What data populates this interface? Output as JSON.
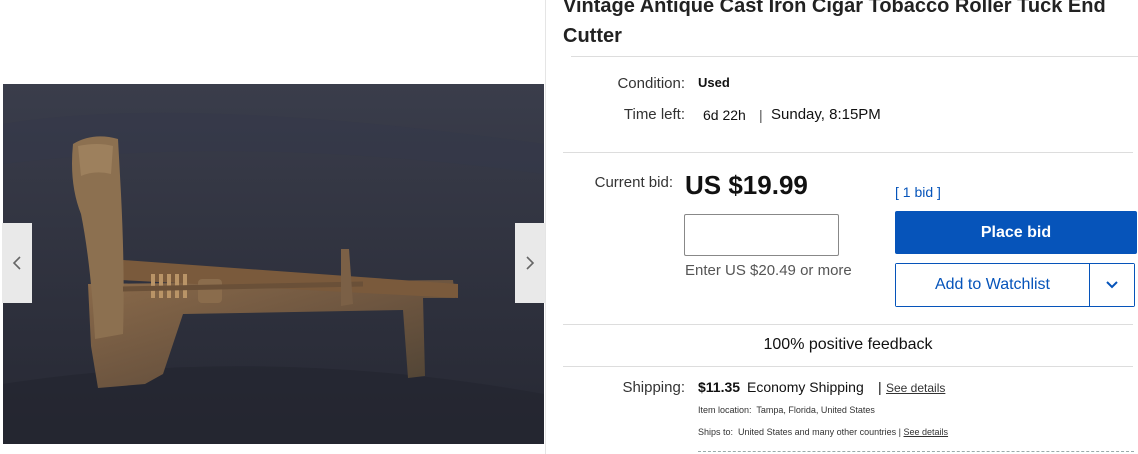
{
  "listing": {
    "title": "Vintage Antique Cast Iron Cigar Tobacco Roller Tuck End Cutter"
  },
  "gallery": {
    "prev_icon": "chevron-left-icon",
    "next_icon": "chevron-right-icon"
  },
  "details": {
    "condition_label": "Condition:",
    "condition_value": "Used",
    "time_left_label": "Time left:",
    "time_left_value": "6d 22h",
    "time_separator": "|",
    "end_time": "Sunday, 8:15PM"
  },
  "bid": {
    "current_bid_label": "Current bid:",
    "current_bid_value": "US $19.99",
    "bid_count": "1 bid",
    "input_value": "",
    "hint": "Enter US $20.49 or more",
    "place_bid_label": "Place bid",
    "watchlist_label": "Add to Watchlist",
    "watchlist_more_icon": "chevron-down-icon"
  },
  "seller": {
    "feedback": "100% positive feedback"
  },
  "shipping": {
    "label": "Shipping:",
    "cost": "$11.35",
    "method": "Economy Shipping",
    "separator": "|",
    "see_details": "See details",
    "item_location_label": "Item location:",
    "item_location_value": "Tampa, Florida, United States",
    "ships_to_label": "Ships to:",
    "ships_to_value": "United States and many other countries",
    "ships_to_separator": "|",
    "ships_to_see_details": "See details"
  },
  "colors": {
    "accent": "#0654ba",
    "divider": "#dddddd"
  }
}
